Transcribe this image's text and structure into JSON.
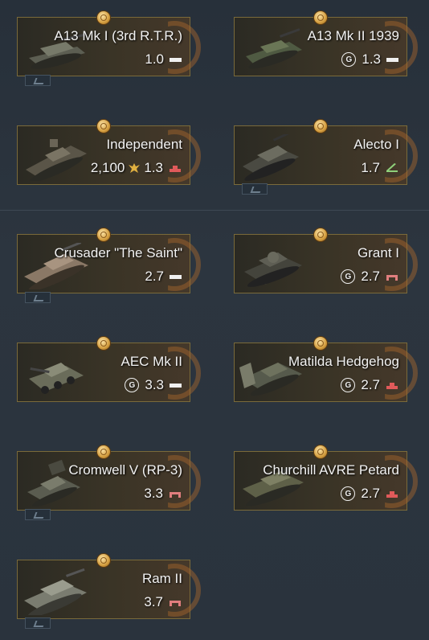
{
  "vehicles": [
    {
      "name": "A13 Mk I (3rd R.T.R.)",
      "br": "1.0",
      "ge": false,
      "rank": "bar",
      "price": ""
    },
    {
      "name": "A13 Mk II 1939",
      "br": "1.3",
      "ge": true,
      "rank": "bar",
      "price": ""
    },
    {
      "name": "Independent",
      "br": "1.3",
      "ge": false,
      "rank": "red",
      "price": "2,100"
    },
    {
      "name": "Alecto I",
      "br": "1.7",
      "ge": false,
      "rank": "green",
      "price": ""
    },
    {
      "name": "Crusader \"The Saint\"",
      "br": "2.7",
      "ge": false,
      "rank": "bar",
      "price": ""
    },
    {
      "name": "Grant I",
      "br": "2.7",
      "ge": true,
      "rank": "pink",
      "price": ""
    },
    {
      "name": "AEC Mk II",
      "br": "3.3",
      "ge": true,
      "rank": "bar",
      "price": ""
    },
    {
      "name": "Matilda Hedgehog",
      "br": "2.7",
      "ge": true,
      "rank": "red",
      "price": ""
    },
    {
      "name": "Cromwell V (RP-3)",
      "br": "3.3",
      "ge": false,
      "rank": "pink",
      "price": ""
    },
    {
      "name": "Churchill AVRE Petard",
      "br": "2.7",
      "ge": true,
      "rank": "red",
      "price": ""
    },
    {
      "name": "Ram II",
      "br": "3.7",
      "ge": false,
      "rank": "pink",
      "price": ""
    }
  ],
  "ge_symbol": "G",
  "colors": {
    "accent_gold": "#d49e3f",
    "rank_red": "#e05a5a",
    "rank_pink": "#e07e7e",
    "rank_green": "#8fd07a",
    "card_border": "#7a6a3a"
  }
}
